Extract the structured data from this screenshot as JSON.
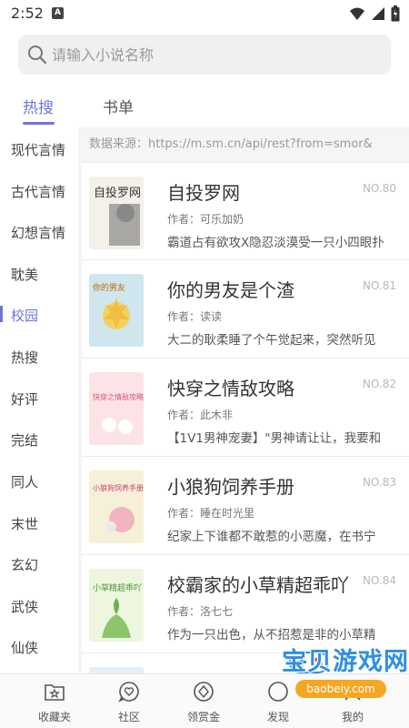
{
  "status_bar": {
    "time": "2:52",
    "app_icon": "A"
  },
  "search": {
    "placeholder": "请输入小说名称"
  },
  "tabs": [
    {
      "label": "热搜",
      "active": true
    },
    {
      "label": "书单",
      "active": false
    }
  ],
  "sidebar": {
    "items": [
      {
        "label": "现代言情"
      },
      {
        "label": "古代言情"
      },
      {
        "label": "幻想言情"
      },
      {
        "label": "耽美"
      },
      {
        "label": "校园"
      },
      {
        "label": "热搜"
      },
      {
        "label": "好评"
      },
      {
        "label": "完结"
      },
      {
        "label": "同人"
      },
      {
        "label": "末世"
      },
      {
        "label": "玄幻"
      },
      {
        "label": "武侠"
      },
      {
        "label": "仙侠"
      }
    ],
    "active_label": "校园"
  },
  "source": {
    "text": "数据来源：https://m.sm.cn/api/rest?from=smor&"
  },
  "books": [
    {
      "title": "自投罗网",
      "rank": "NO.80",
      "author": "作者：可乐加奶",
      "desc": "霸道占有欲攻X隐忍淡漠受一只小四眼扑"
    },
    {
      "title": "你的男友是个渣",
      "rank": "NO.81",
      "author": "作者：读读",
      "desc": "大二的耿柔睡了个午觉起来，突然听见"
    },
    {
      "title": "快穿之情敌攻略",
      "rank": "NO.82",
      "author": "作者：此木非",
      "desc": "【1V1男神宠妻】\"男神请让让，我要和"
    },
    {
      "title": "小狼狗饲养手册",
      "rank": "NO.83",
      "author": "作者：睡在时光里",
      "desc": "纪家上下谁都不敢惹的小恶魔，在书宁"
    },
    {
      "title": "校霸家的小草精超乖吖",
      "rank": "NO.84",
      "author": "作者：洛七七",
      "desc": "作为一只出色，从不招惹是非的小草精"
    }
  ],
  "covers": [
    {
      "text": "自投罗网",
      "bg": "#f4f1ea",
      "fg": "#333333"
    },
    {
      "text": "你的男友",
      "bg": "#cfe6ef",
      "fg": "#c06a00"
    },
    {
      "text": "快穿之情敌攻略",
      "bg": "#fbe3e6",
      "fg": "#d45778"
    },
    {
      "text": "小狼狗饲养手册",
      "bg": "#f7f0d8",
      "fg": "#c2456a"
    },
    {
      "text": "小草精超乖吖",
      "bg": "#eef6e0",
      "fg": "#4b9a2f"
    }
  ],
  "bottom_nav": [
    {
      "label": "收藏夹",
      "icon": "folder-star-icon"
    },
    {
      "label": "社区",
      "icon": "heart-chat-icon"
    },
    {
      "label": "领赏金",
      "icon": "diamond-icon"
    },
    {
      "label": "发现",
      "icon": "compass-icon"
    },
    {
      "label": "我的",
      "icon": "user-icon"
    }
  ],
  "watermark": {
    "text": "宝贝游戏网",
    "url": "baobeiy.com"
  },
  "colors": {
    "accent": "#7075d9",
    "watermark_blue": "#2f8fe0",
    "watermark_orange": "#f5a623"
  }
}
